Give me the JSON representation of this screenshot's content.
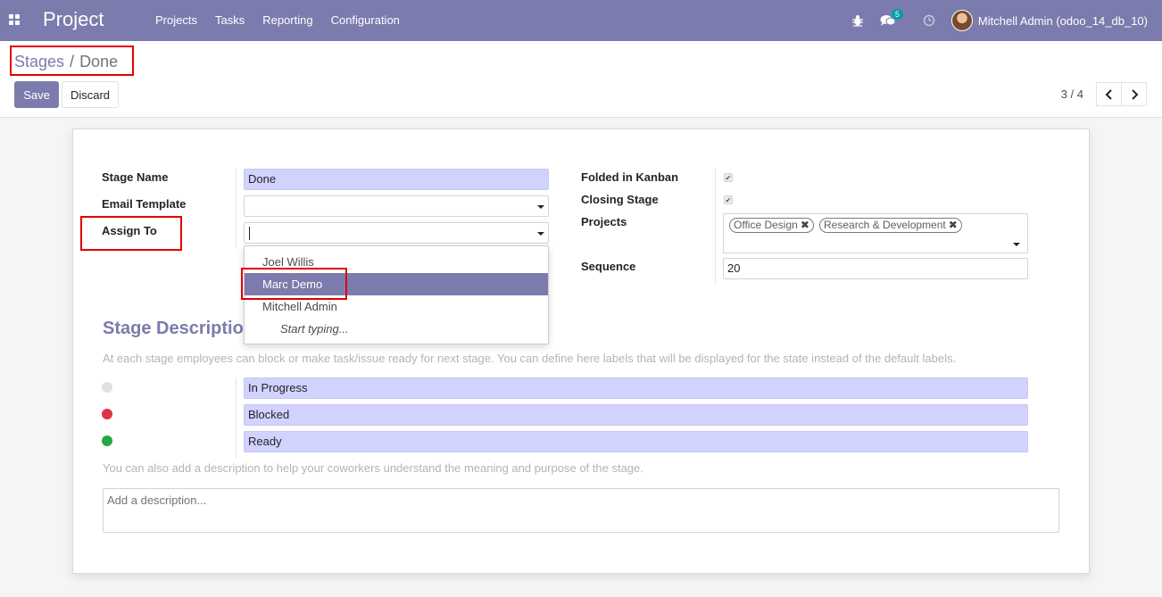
{
  "navbar": {
    "app_title": "Project",
    "menu": [
      "Projects",
      "Tasks",
      "Reporting",
      "Configuration"
    ],
    "chat_count": "5",
    "user_name": "Mitchell Admin (odoo_14_db_10)",
    "bg_color": "#7c7bad",
    "icons": [
      "apps-grid-icon",
      "bug-icon",
      "chat-icon",
      "clock-icon"
    ]
  },
  "breadcrumb": {
    "parent": "Stages",
    "separator": "/",
    "current": "Done"
  },
  "buttons": {
    "save": "Save",
    "discard": "Discard"
  },
  "pager": {
    "value": "3 / 4"
  },
  "form": {
    "stage_name_label": "Stage Name",
    "stage_name_value": "Done",
    "email_template_label": "Email Template",
    "email_template_value": "",
    "assign_to_label": "Assign To",
    "assign_to_value": "",
    "folded_label": "Folded in Kanban",
    "folded_checked": true,
    "closing_label": "Closing Stage",
    "closing_checked": true,
    "projects_label": "Projects",
    "projects_tags": [
      "Office Design",
      "Research & Development"
    ],
    "sequence_label": "Sequence",
    "sequence_value": "20"
  },
  "dropdown": {
    "items": [
      "Joel Willis",
      "Marc Demo",
      "Mitchell Admin"
    ],
    "active_index": 1,
    "hint": "Start typing..."
  },
  "description_section": {
    "title": "Stage Description",
    "help": "At each stage employees can block or make task/issue ready for next stage. You can define here labels that will be displayed for the state instead of the default labels.",
    "states": [
      {
        "color": "#dee2e6",
        "label": "In Progress"
      },
      {
        "color": "#dc3545",
        "label": "Blocked"
      },
      {
        "color": "#28a745",
        "label": "Ready"
      }
    ],
    "help2": "You can also add a description to help your coworkers understand the meaning and purpose of the stage.",
    "description_placeholder": "Add a description..."
  }
}
